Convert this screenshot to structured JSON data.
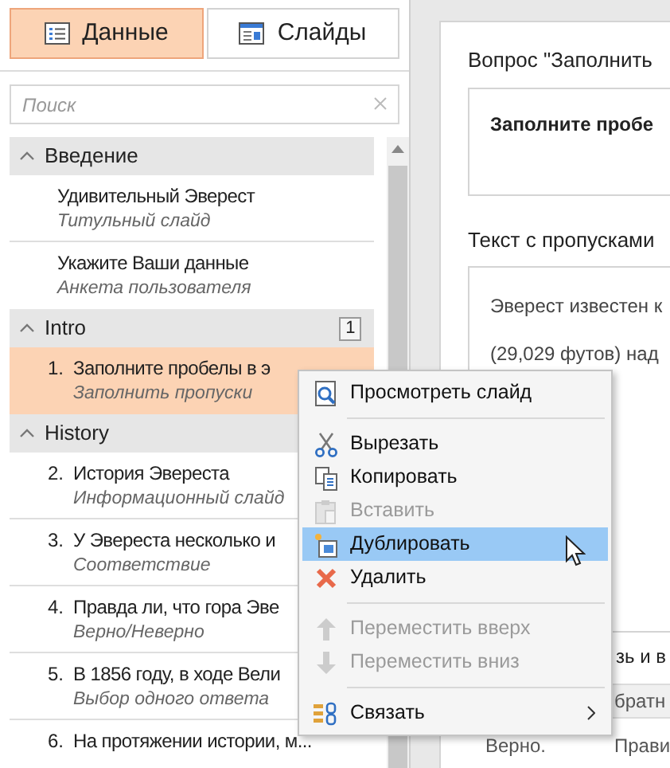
{
  "tabs": [
    {
      "label": "Данные",
      "selected": true
    },
    {
      "label": "Слайды",
      "selected": false
    }
  ],
  "search": {
    "placeholder": "Поиск"
  },
  "outline": [
    {
      "title": "Введение",
      "expanded": true,
      "children": [
        {
          "title": "Удивительный Эверест",
          "subtitle": "Титульный слайд",
          "selected": false
        },
        {
          "title": "Укажите Ваши данные",
          "subtitle": "Анкета пользователя",
          "selected": false
        }
      ]
    },
    {
      "title": "Intro",
      "expanded": true,
      "badge": "1",
      "children": [
        {
          "number": "1.",
          "title": "Заполните пробелы в э",
          "subtitle": "Заполнить пропуски",
          "selected": true
        }
      ]
    },
    {
      "title": "History",
      "expanded": true,
      "children": [
        {
          "number": "2.",
          "title": "История Эвереста",
          "subtitle": "Информационный слайд",
          "selected": false
        },
        {
          "number": "3.",
          "title": "У Эвереста несколько и",
          "subtitle": "Соответствие",
          "selected": false
        },
        {
          "number": "4.",
          "title": "Правда ли, что гора Эве",
          "subtitle": "Верно/Неверно",
          "selected": false
        },
        {
          "number": "5.",
          "title": "В 1856 году, в ходе Вели",
          "subtitle": "Выбор одного ответа",
          "selected": false
        },
        {
          "number": "6.",
          "title": "На протяжении истории, м...",
          "selected": false
        }
      ]
    }
  ],
  "editor": {
    "question_label": "Вопрос \"Заполнить",
    "question_text": "Заполните пробе",
    "text_label": "Текст с пропусками",
    "text_lines": [
      "Эверест известен к",
      "(29,029 футов) над"
    ],
    "feedback_heading": "зь и в",
    "feedback_header_cell": "братн",
    "feedback_row": [
      "Верно.",
      "Прави"
    ]
  },
  "context_menu": [
    {
      "kind": "item",
      "label": "Просмотреть слайд",
      "disabled": false,
      "selected": false,
      "submenu": false
    },
    {
      "kind": "separator"
    },
    {
      "kind": "item",
      "label": "Вырезать",
      "disabled": false,
      "selected": false,
      "submenu": false
    },
    {
      "kind": "item",
      "label": "Копировать",
      "disabled": false,
      "selected": false,
      "submenu": false
    },
    {
      "kind": "item",
      "label": "Вставить",
      "disabled": true,
      "selected": false,
      "submenu": false
    },
    {
      "kind": "item",
      "label": "Дублировать",
      "disabled": false,
      "selected": true,
      "submenu": false
    },
    {
      "kind": "item",
      "label": "Удалить",
      "disabled": false,
      "selected": false,
      "submenu": false
    },
    {
      "kind": "separator"
    },
    {
      "kind": "item",
      "label": "Переместить вверх",
      "disabled": true,
      "selected": false,
      "submenu": false
    },
    {
      "kind": "item",
      "label": "Переместить вниз",
      "disabled": true,
      "selected": false,
      "submenu": false
    },
    {
      "kind": "separator"
    },
    {
      "kind": "item",
      "label": "Связать",
      "disabled": false,
      "selected": false,
      "submenu": true
    }
  ]
}
